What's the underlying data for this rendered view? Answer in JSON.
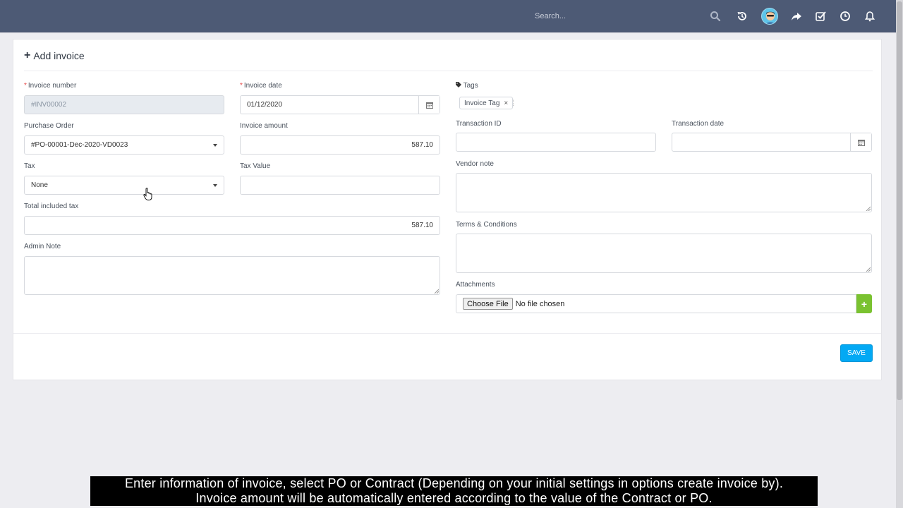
{
  "topbar": {
    "search_placeholder": "Search...",
    "icons": [
      "search-icon",
      "history-icon",
      "avatar",
      "share-icon",
      "task-check-icon",
      "clock-icon",
      "bell-icon"
    ]
  },
  "panel": {
    "title": "Add invoice"
  },
  "form": {
    "invoice_number": {
      "label": "Invoice number",
      "value": "#INV00002",
      "required": true
    },
    "invoice_date": {
      "label": "Invoice date",
      "value": "01/12/2020",
      "required": true
    },
    "purchase_order": {
      "label": "Purchase Order",
      "value": "#PO-00001-Dec-2020-VD0023"
    },
    "invoice_amount": {
      "label": "Invoice amount",
      "value": "587.10"
    },
    "tax": {
      "label": "Tax",
      "value": "None"
    },
    "tax_value": {
      "label": "Tax Value",
      "value": ""
    },
    "total_included_tax": {
      "label": "Total included tax",
      "value": "587.10"
    },
    "admin_note": {
      "label": "Admin Note",
      "value": ""
    },
    "tags": {
      "label": "Tags",
      "items": [
        "Invoice Tag"
      ]
    },
    "transaction_id": {
      "label": "Transaction ID",
      "value": ""
    },
    "transaction_date": {
      "label": "Transaction date",
      "value": ""
    },
    "vendor_note": {
      "label": "Vendor note",
      "value": ""
    },
    "terms": {
      "label": "Terms & Conditions",
      "value": ""
    },
    "attachments": {
      "label": "Attachments",
      "button": "Choose File",
      "status": "No file chosen",
      "add": "+"
    },
    "required_mark": "*"
  },
  "actions": {
    "save_label": "SAVE"
  },
  "subtitles": {
    "line1": "Enter information of invoice, select PO or Contract (Depending on your initial settings in options create invoice by).",
    "line2": "Invoice amount will be automatically entered according to the value of the Contract or PO."
  },
  "colors": {
    "topbar": "#4d5a75",
    "save": "#03a9f4",
    "add": "#7ac230",
    "required": "#e64a4a"
  }
}
